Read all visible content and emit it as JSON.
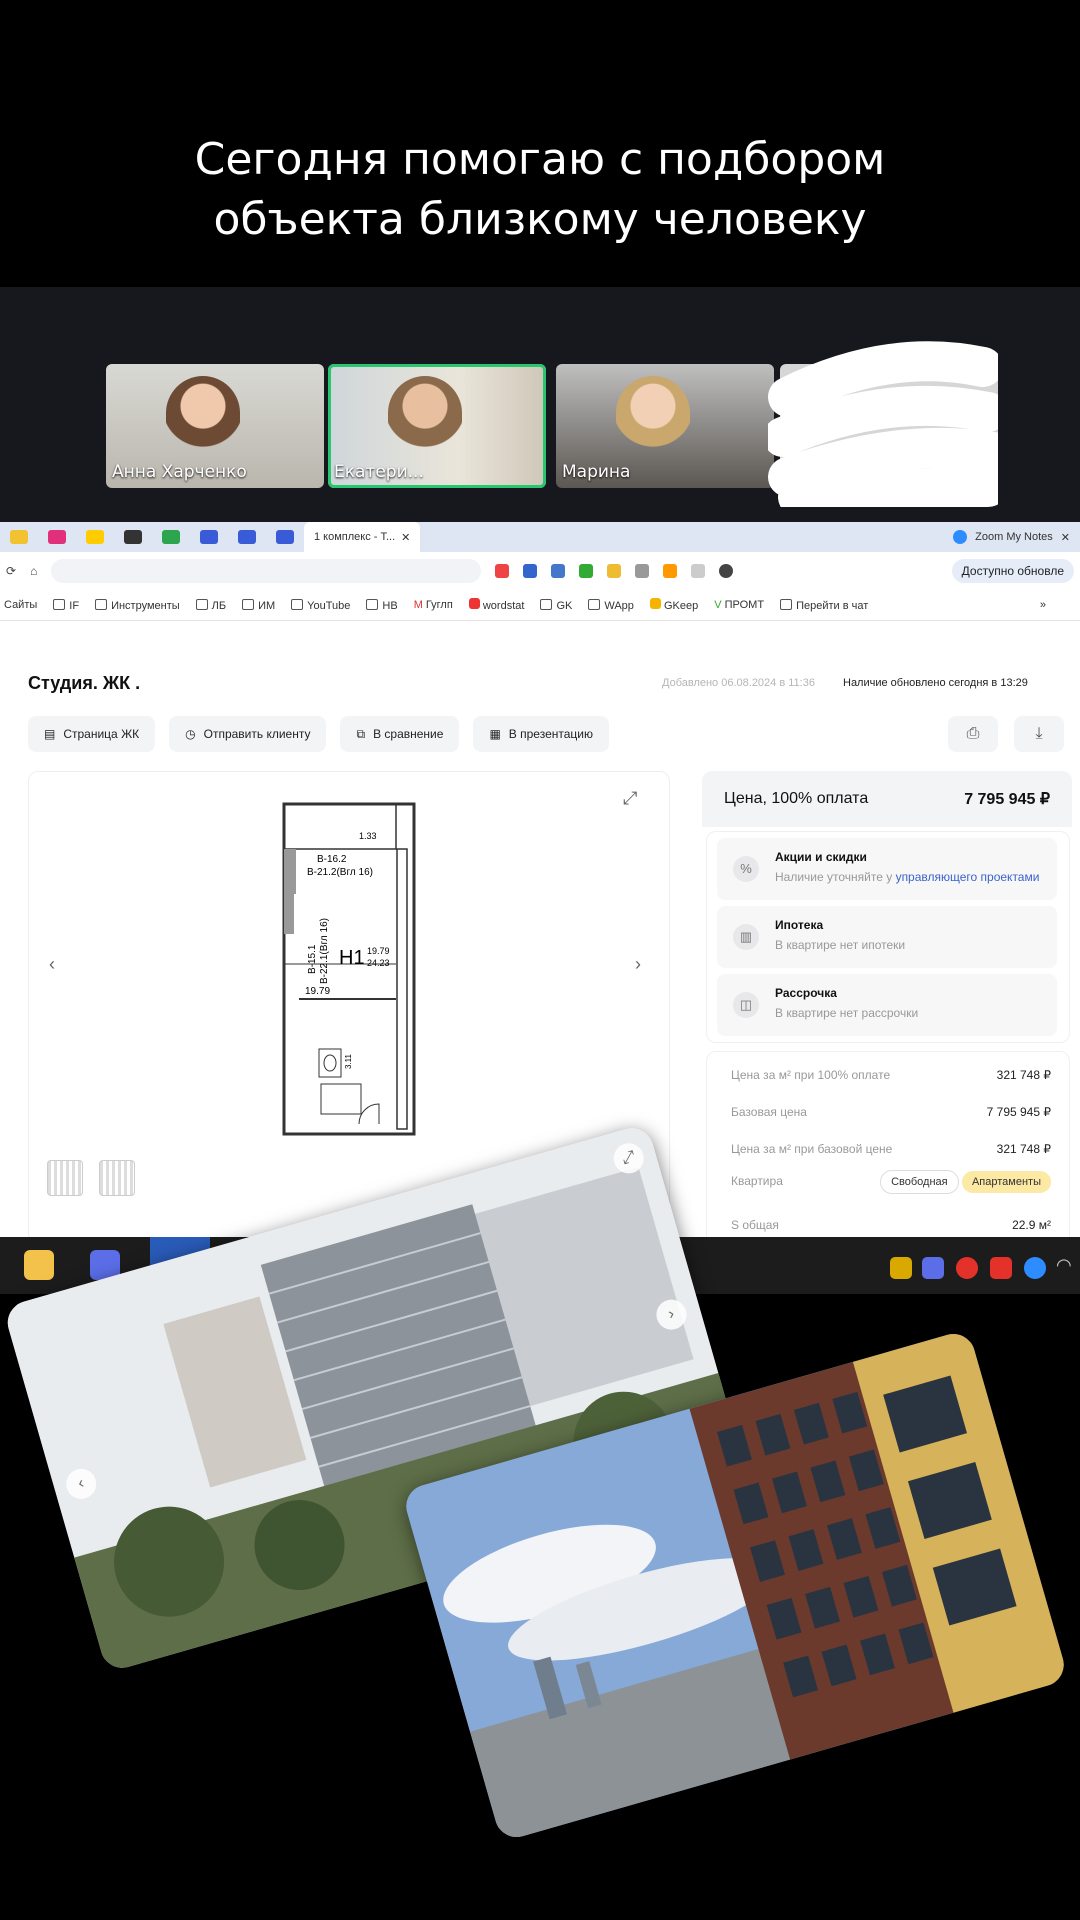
{
  "caption": {
    "line1": "Сегодня помогаю с подбором",
    "line2": "объекта близкому человеку"
  },
  "video_call": {
    "participants": [
      {
        "name": "Анна Харченко"
      },
      {
        "name": "Екатери..."
      },
      {
        "name": "Марина"
      }
    ]
  },
  "browser": {
    "active_tab": "1 комплекс - Т...",
    "zoom_tab": "Zoom My Notes",
    "update_label": "Доступно обновле",
    "bookmarks": [
      "Сайты",
      "IF",
      "Инструменты",
      "ЛБ",
      "ИМ",
      "YouTube",
      "НВ",
      "Гуглп",
      "wordstat",
      "GK",
      "WApp",
      "GKeep",
      "ПРОМТ",
      "Перейти в чат"
    ]
  },
  "listing": {
    "title": "Студия. ЖК .",
    "added": "Добавлено 06.08.2024 в 11:36",
    "availability": "Наличие обновлено сегодня в 13:29",
    "actions": [
      "Страница ЖК",
      "Отправить клиенту",
      "В сравнение",
      "В презентацию"
    ],
    "plan_labels": {
      "top": "1.33",
      "dim1": "В-16.2",
      "dim2": "В-21.2(Вгл 16)",
      "side1": "В-15.1",
      "side2": "В-22.1(Вгл 16)",
      "unit": "Н1",
      "area_top": "19.79",
      "area_bottom": "24.23",
      "room_area": "19.79",
      "bath": "3.11"
    },
    "price_label": "Цена, 100% оплата",
    "price_value": "7 795 945 ₽",
    "options": [
      {
        "title": "Акции и скидки",
        "subtitle": "Наличие уточняйте у ",
        "link": "управляющего проектами"
      },
      {
        "title": "Ипотека",
        "subtitle": "В квартире нет ипотеки"
      },
      {
        "title": "Рассрочка",
        "subtitle": "В квартире нет рассрочки"
      }
    ],
    "specs": [
      {
        "key": "Цена за м² при 100% оплате",
        "value": "321 748 ₽"
      },
      {
        "key": "Базовая цена",
        "value": "7 795 945 ₽"
      },
      {
        "key": "Цена за м² при базовой цене",
        "value": "321 748 ₽"
      }
    ],
    "type_row": {
      "key": "Квартира",
      "badge1": "Свободная",
      "badge2": "Апартаменты"
    },
    "area_row": {
      "key": "S общая",
      "value": "22.9 м²"
    }
  },
  "colors": {
    "active_speaker": "#28c76f",
    "link": "#3b63c9",
    "apartments_badge": "#fbe9a4"
  }
}
